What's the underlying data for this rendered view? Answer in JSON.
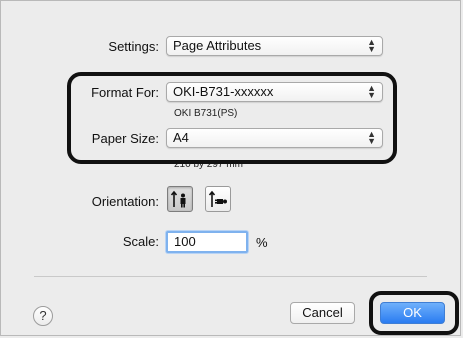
{
  "settings": {
    "label": "Settings:",
    "value": "Page Attributes"
  },
  "format_for": {
    "label": "Format For:",
    "value": "OKI-B731-xxxxxx",
    "printer_model": "OKI B731(PS)"
  },
  "paper_size": {
    "label": "Paper Size:",
    "value": "A4",
    "dimensions": "210 by 297 mm"
  },
  "orientation": {
    "label": "Orientation:",
    "selected": "portrait"
  },
  "scale": {
    "label": "Scale:",
    "value": "100",
    "unit": "%"
  },
  "buttons": {
    "help": "?",
    "cancel": "Cancel",
    "ok": "OK"
  },
  "icons": {
    "popup_arrows": "updown-chevron-icon",
    "portrait": "portrait-orientation-icon",
    "landscape": "landscape-orientation-icon"
  },
  "colors": {
    "ok_button": "#2a7cf1",
    "highlight_border": "#111111",
    "field_focus": "#7fb2ee"
  }
}
